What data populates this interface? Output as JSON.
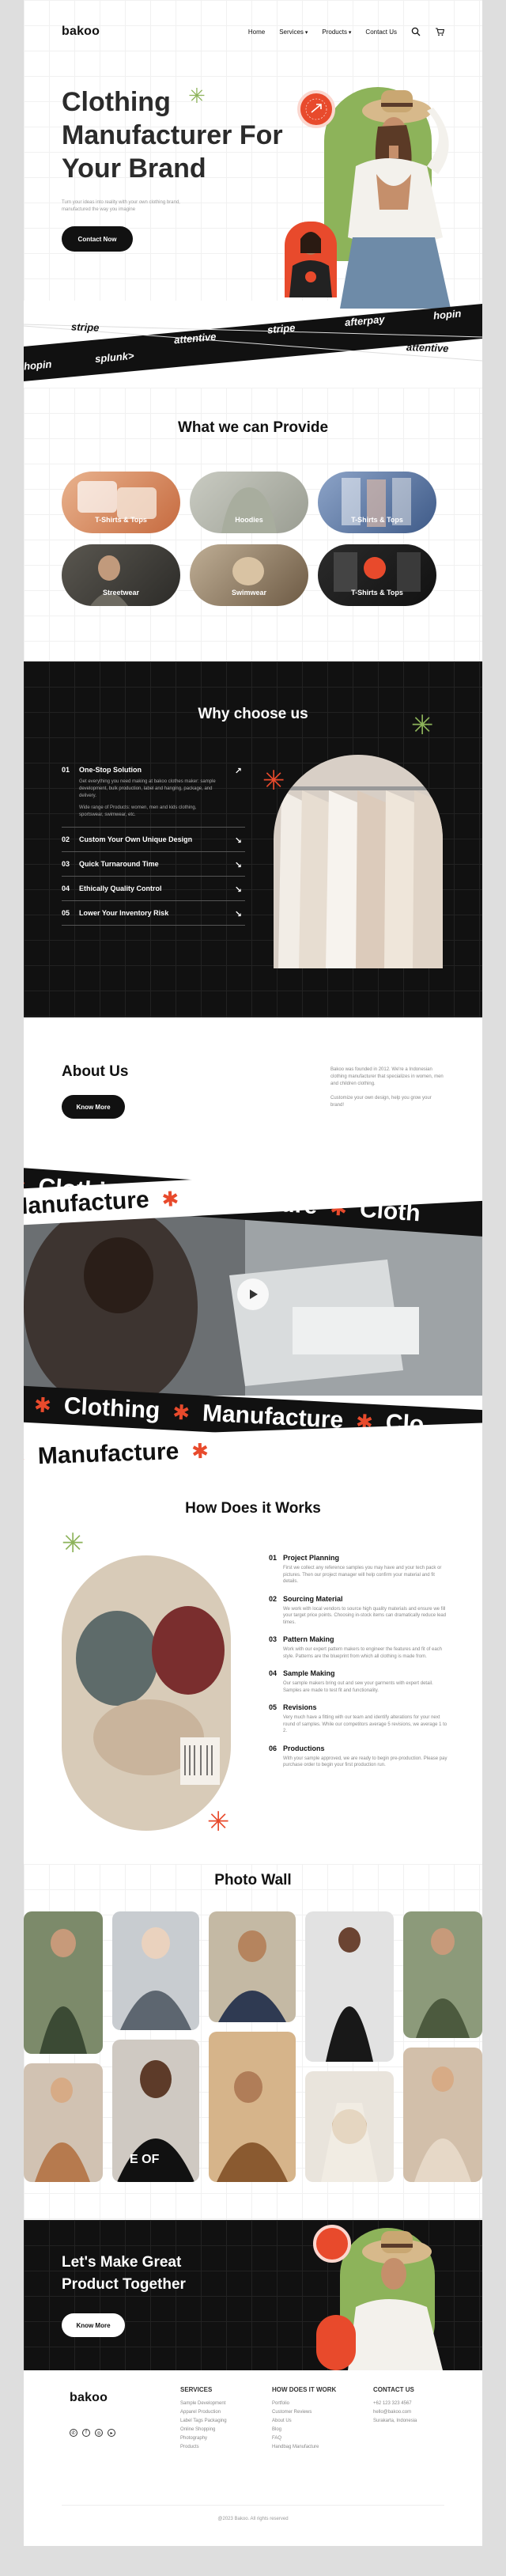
{
  "nav": {
    "logo": "bakoo",
    "items": [
      "Home",
      "Services",
      "Products",
      "Contact Us"
    ]
  },
  "hero": {
    "title": "Clothing Manufacturer For Your Brand",
    "subtitle": "Turn your ideas into reality with your own clothing brand, manufactured the way you imagine",
    "cta": "Contact Now"
  },
  "partners": [
    "stripe",
    "attentive",
    "stripe",
    "afterpay",
    "hopin",
    "hopin",
    "splunk>",
    "attentive",
    "stripe",
    "afterpay",
    "attentive"
  ],
  "services": {
    "title": "What we can Provide",
    "items": [
      "T-Shirts & Tops",
      "Hoodies",
      "T-Shirts & Tops",
      "Streetwear",
      "Swimwear",
      "T-Shirts & Tops"
    ]
  },
  "why": {
    "title": "Why choose us",
    "items": [
      {
        "num": "01",
        "label": "One-Stop Solution",
        "desc": "Get everything you need making at bakoo clothes maker: sample development, bulk production, label and hanging, package, and delivery.",
        "desc2": "Wide range of Products: women, men and kids clothing, sportswear, swimwear, etc."
      },
      {
        "num": "02",
        "label": "Custom Your Own Unique Design"
      },
      {
        "num": "03",
        "label": "Quick Turnaround Time"
      },
      {
        "num": "04",
        "label": "Ethically Quality Control"
      },
      {
        "num": "05",
        "label": "Lower Your Inventory Risk"
      }
    ]
  },
  "about": {
    "title": "About Us",
    "cta": "Know More",
    "text1": "Bakoo was founded in 2012. We're a Indonesian clothing manufacturer that specializes in women, men and children clothing.",
    "text2": "Customize your own design, help you grow your brand!"
  },
  "ribbon": {
    "word1": "Clothing",
    "word2": "Manufacture",
    "word3": "Cloth",
    "word4": "Manufacture",
    "word5": "Clothing",
    "word6": "Manufacture",
    "word7": "Clo",
    "word8": "e",
    "word9": "Manufacture"
  },
  "how": {
    "title": "How Does it Works",
    "steps": [
      {
        "num": "01",
        "label": "Project Planning",
        "desc": "First we collect any reference samples you may have and your tech pack or pictures. Then our project manager will help confirm your material and fit details."
      },
      {
        "num": "02",
        "label": "Sourcing Material",
        "desc": "We work with local vendors to source high quality materials and ensure we fill your target price points. Choosing in-stock items can dramatically reduce lead times."
      },
      {
        "num": "03",
        "label": "Pattern Making",
        "desc": "Work with our expert pattern makers to engineer the features and fit of each style. Patterns are the blueprint from which all clothing is made from."
      },
      {
        "num": "04",
        "label": "Sample Making",
        "desc": "Our sample makers bring out and sew your garments with expert detail. Samples are made to test fit and functionality."
      },
      {
        "num": "05",
        "label": "Revisions",
        "desc": "Very much have a fitting with our team and identify alterations for your next round of samples. While our competitors average 5 revisions, we average 1 to 2."
      },
      {
        "num": "06",
        "label": "Productions",
        "desc": "With your sample approved, we are ready to begin pre-production. Please pay purchase order to begin your first production run."
      }
    ]
  },
  "wall": {
    "title": "Photo Wall"
  },
  "cta_section": {
    "title": "Let's Make Great Product Together",
    "cta": "Know More"
  },
  "footer": {
    "logo": "bakoo",
    "services_title": "SERVICES",
    "services": [
      "Sample Development",
      "Apparel Production",
      "Label Tags Packaging",
      "Online Shopping",
      "Photography",
      "Products"
    ],
    "how_title": "HOW DOES IT WORK",
    "how": [
      "Portfolio",
      "Customer Reviews",
      "About Us",
      "Blog",
      "FAQ",
      "Handbag Manufacture"
    ],
    "contact_title": "CONTACT US",
    "contact": [
      "+62 123 323 4567",
      "hello@bakoo.com",
      "Surakarta, Indonesia"
    ],
    "copyright": "@2023 Bakoo. All rights reserved"
  },
  "colors": {
    "accent": "#e84a2c",
    "green": "#8db35a",
    "dark": "#111111"
  }
}
